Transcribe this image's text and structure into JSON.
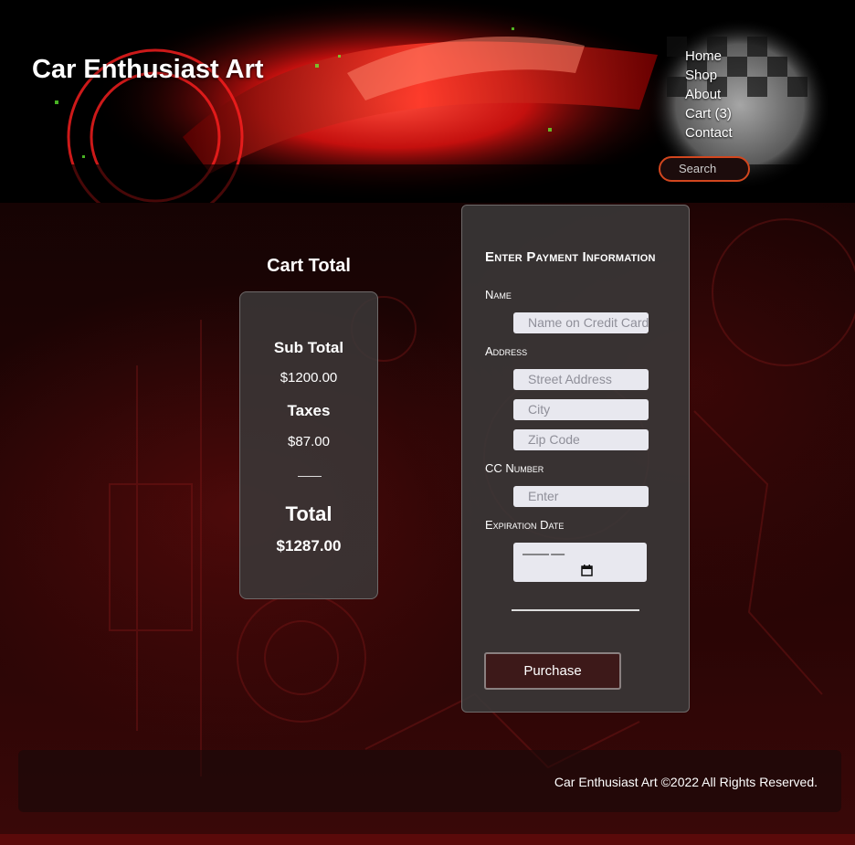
{
  "site": {
    "title": "Car Enthusiast Art"
  },
  "nav": {
    "items": [
      {
        "label": "Home"
      },
      {
        "label": "Shop"
      },
      {
        "label": "About"
      },
      {
        "label": "Cart (3)"
      },
      {
        "label": "Contact"
      }
    ],
    "search_placeholder": "Search"
  },
  "cart": {
    "title": "Cart Total",
    "subtotal_label": "Sub Total",
    "subtotal_value": "$1200.00",
    "taxes_label": "Taxes",
    "taxes_value": "$87.00",
    "total_label": "Total",
    "total_value": "$1287.00"
  },
  "payment": {
    "title": "Enter Payment Information",
    "name_label": "Name",
    "name_placeholder": "Name on Credit Card",
    "address_label": "Address",
    "street_placeholder": "Street Address",
    "city_placeholder": "City",
    "zip_placeholder": "Zip Code",
    "cc_label": "CC Number",
    "cc_placeholder": "Enter",
    "exp_label": "Expiration Date",
    "exp_value": "—— —",
    "purchase_label": "Purchase"
  },
  "footer": {
    "copyright": "Car Enthusiast Art ©2022 All Rights Reserved."
  },
  "colors": {
    "accent": "#d2461e",
    "panel": "#3a3737",
    "button": "#3d1919"
  }
}
